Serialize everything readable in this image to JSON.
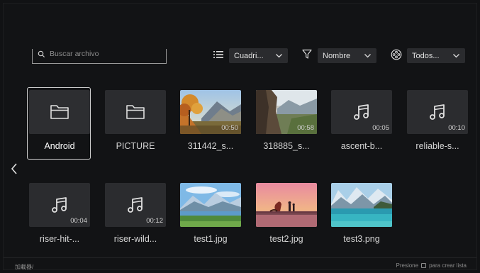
{
  "search": {
    "placeholder": "Buscar archivo",
    "icon": "search-icon"
  },
  "toolbar": {
    "view": {
      "icon": "list-icon",
      "value": "Cuadri..."
    },
    "sort": {
      "icon": "filter-icon",
      "value": "Nombre"
    },
    "type": {
      "icon": "media-reel-icon",
      "value": "Todos..."
    }
  },
  "items": [
    {
      "label": "Android",
      "kind": "folder"
    },
    {
      "label": "PICTURE",
      "kind": "folder"
    },
    {
      "label": "311442_s...",
      "kind": "video",
      "duration": "00:50"
    },
    {
      "label": "318885_s...",
      "kind": "video",
      "duration": "00:58"
    },
    {
      "label": "ascent-b...",
      "kind": "audio",
      "duration": "00:05"
    },
    {
      "label": "reliable-s...",
      "kind": "audio",
      "duration": "00:10"
    },
    {
      "label": "riser-hit-...",
      "kind": "audio",
      "duration": "00:04"
    },
    {
      "label": "riser-wild...",
      "kind": "audio",
      "duration": "00:12"
    },
    {
      "label": "test1.jpg",
      "kind": "image"
    },
    {
      "label": "test2.jpg",
      "kind": "image"
    },
    {
      "label": "test3.png",
      "kind": "image"
    }
  ],
  "footer": {
    "path": "加載器/",
    "hint_prefix": "Presione",
    "hint_suffix": "para crear lista"
  }
}
